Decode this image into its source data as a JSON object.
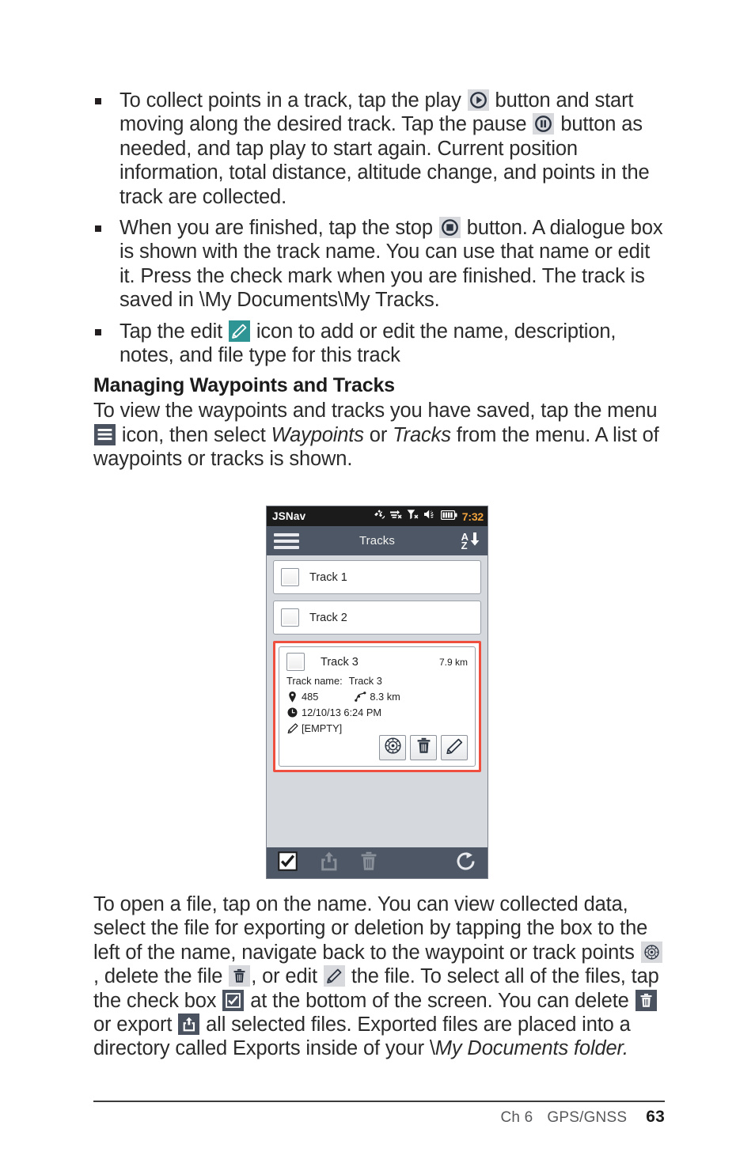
{
  "body": {
    "bullets": [
      {
        "id": "collect-points",
        "parts": [
          {
            "t": "text",
            "v": "To collect points in a track, tap the play "
          },
          {
            "t": "icon",
            "name": "play-icon",
            "style": "grey"
          },
          {
            "t": "text",
            "v": " button and start moving along the desired track. Tap the pause "
          },
          {
            "t": "icon",
            "name": "pause-icon",
            "style": "grey"
          },
          {
            "t": "text",
            "v": " button as needed, and tap play to start again. Current position information, total distance, altitude change, and points in the track are collected."
          }
        ]
      },
      {
        "id": "finish-stop",
        "parts": [
          {
            "t": "text",
            "v": "When you are finished, tap the stop "
          },
          {
            "t": "icon",
            "name": "stop-icon",
            "style": "grey"
          },
          {
            "t": "text",
            "v": " button. A dialogue box is shown with the track name. You can use that name or edit it. Press the check mark when you are finished. The track is saved in \\My Documents\\My Tracks."
          }
        ]
      },
      {
        "id": "edit-icon-note",
        "parts": [
          {
            "t": "text",
            "v": "Tap the edit "
          },
          {
            "t": "icon",
            "name": "edit-pencil-icon",
            "style": "teal"
          },
          {
            "t": "text",
            "v": " icon to add or edit the name, description, notes, and file type for this track"
          }
        ]
      }
    ],
    "section_title": "Managing Waypoints and Tracks",
    "intro_paragraph": [
      {
        "t": "text",
        "v": "To view the waypoints and tracks you have saved, tap the menu "
      },
      {
        "t": "icon",
        "name": "hamburger-menu-icon",
        "style": "dark"
      },
      {
        "t": "text",
        "v": " icon, then select "
      },
      {
        "t": "italic",
        "v": "Waypoints"
      },
      {
        "t": "text",
        "v": " or "
      },
      {
        "t": "italic",
        "v": "Tracks"
      },
      {
        "t": "text",
        "v": " from the menu. A list of waypoints or tracks is shown."
      }
    ],
    "closing_paragraph": [
      {
        "t": "text",
        "v": "To open a file, tap on the name. You can view collected data, select the file for exporting or deletion by tapping the box to the left of the name, navigate back to the waypoint or track points "
      },
      {
        "t": "icon",
        "name": "compass-icon",
        "style": "grey"
      },
      {
        "t": "text",
        "v": ", delete the file "
      },
      {
        "t": "icon",
        "name": "trash-icon",
        "style": "grey"
      },
      {
        "t": "text",
        "v": ", or edit "
      },
      {
        "t": "icon",
        "name": "edit-pencil-icon",
        "style": "grey"
      },
      {
        "t": "text",
        "v": " the file. To select all of the files, tap the check box "
      },
      {
        "t": "icon",
        "name": "checkbox-checked-icon",
        "style": "dark"
      },
      {
        "t": "text",
        "v": " at the bottom of the screen. You can delete "
      },
      {
        "t": "icon",
        "name": "trash-icon",
        "style": "dark"
      },
      {
        "t": "text",
        "v": " or export "
      },
      {
        "t": "icon",
        "name": "export-icon",
        "style": "dark"
      },
      {
        "t": "text",
        "v": " all selected files. Exported files are placed into a directory called Exports inside of your \\"
      },
      {
        "t": "italic",
        "v": "My Documents folder."
      }
    ]
  },
  "device": {
    "statusbar": {
      "app_name": "JSNav",
      "time": "7:32",
      "icons": [
        "satellite-icon",
        "sync-disabled-icon",
        "signal-disabled-icon",
        "speaker-icon",
        "battery-icon"
      ],
      "clock_color": "#f0a23c"
    },
    "titlebar": {
      "menu_icon": "hamburger-menu-icon",
      "title": "Tracks",
      "sort_label_top": "A",
      "sort_label_bottom": "Z",
      "sort_icon": "sort-descending-icon"
    },
    "tracks": [
      {
        "name": "Track 1",
        "selected": false
      },
      {
        "name": "Track 2",
        "selected": false
      }
    ],
    "expanded_card": {
      "name": "Track 3",
      "distance_badge": "7.9 km",
      "track_name_label": "Track name:",
      "track_name_value": "Track 3",
      "points_count": "485",
      "path_length": "8.3 km",
      "timestamp": "12/10/13 6:24 PM",
      "notes": "[EMPTY]",
      "highlight_color": "#ee4f3e",
      "actions": [
        {
          "name": "navigate-button",
          "icon": "compass-icon"
        },
        {
          "name": "delete-button",
          "icon": "trash-icon"
        },
        {
          "name": "edit-button",
          "icon": "edit-pencil-icon"
        }
      ]
    },
    "bottombar": {
      "items": [
        {
          "name": "select-all-button",
          "icon": "checkbox-checked-icon",
          "enabled": true
        },
        {
          "name": "export-button",
          "icon": "export-icon",
          "enabled": false
        },
        {
          "name": "delete-button",
          "icon": "trash-icon",
          "enabled": false
        },
        {
          "name": "refresh-button",
          "icon": "refresh-icon",
          "enabled": true
        }
      ]
    },
    "colors": {
      "titlebar": "#4d5765",
      "body": "#d5d8dd",
      "statusbar": "#1b1b1b"
    }
  },
  "footer": {
    "chapter": "Ch 6",
    "section": "GPS/GNSS",
    "page_number": "63"
  }
}
